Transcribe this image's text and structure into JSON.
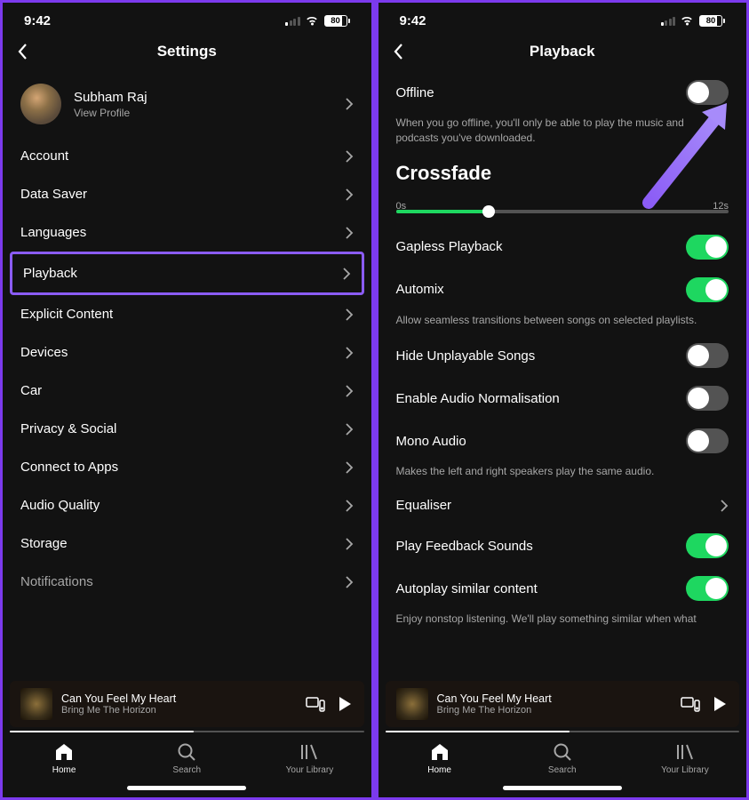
{
  "status": {
    "time": "9:42",
    "battery": "80"
  },
  "left": {
    "title": "Settings",
    "profile": {
      "name": "Subham Raj",
      "sub": "View Profile"
    },
    "items": [
      {
        "label": "Account"
      },
      {
        "label": "Data Saver"
      },
      {
        "label": "Languages"
      },
      {
        "label": "Playback",
        "highlight": true
      },
      {
        "label": "Explicit Content"
      },
      {
        "label": "Devices"
      },
      {
        "label": "Car"
      },
      {
        "label": "Privacy & Social"
      },
      {
        "label": "Connect to Apps"
      },
      {
        "label": "Audio Quality"
      },
      {
        "label": "Storage"
      },
      {
        "label": "Notifications",
        "dim": true
      }
    ]
  },
  "right": {
    "title": "Playback",
    "offline": {
      "label": "Offline",
      "state": "off",
      "help": "When you go offline, you'll only be able to play the music and podcasts you've downloaded."
    },
    "crossfade": {
      "title": "Crossfade",
      "min": "0s",
      "max": "12s",
      "value_pct": 28
    },
    "toggles": [
      {
        "label": "Gapless Playback",
        "state": "on"
      },
      {
        "label": "Automix",
        "state": "on",
        "help": "Allow seamless transitions between songs on selected playlists."
      },
      {
        "label": "Hide Unplayable Songs",
        "state": "off"
      },
      {
        "label": "Enable Audio Normalisation",
        "state": "off"
      },
      {
        "label": "Mono Audio",
        "state": "off",
        "help": "Makes the left and right speakers play the same audio."
      }
    ],
    "equaliser": "Equaliser",
    "toggles2": [
      {
        "label": "Play Feedback Sounds",
        "state": "on"
      },
      {
        "label": "Autoplay similar content",
        "state": "on",
        "help": "Enjoy nonstop listening. We'll play something similar when what"
      }
    ]
  },
  "now_playing": {
    "title": "Can You Feel My Heart",
    "artist": "Bring Me The Horizon"
  },
  "tabs": {
    "home": "Home",
    "search": "Search",
    "library": "Your Library"
  }
}
